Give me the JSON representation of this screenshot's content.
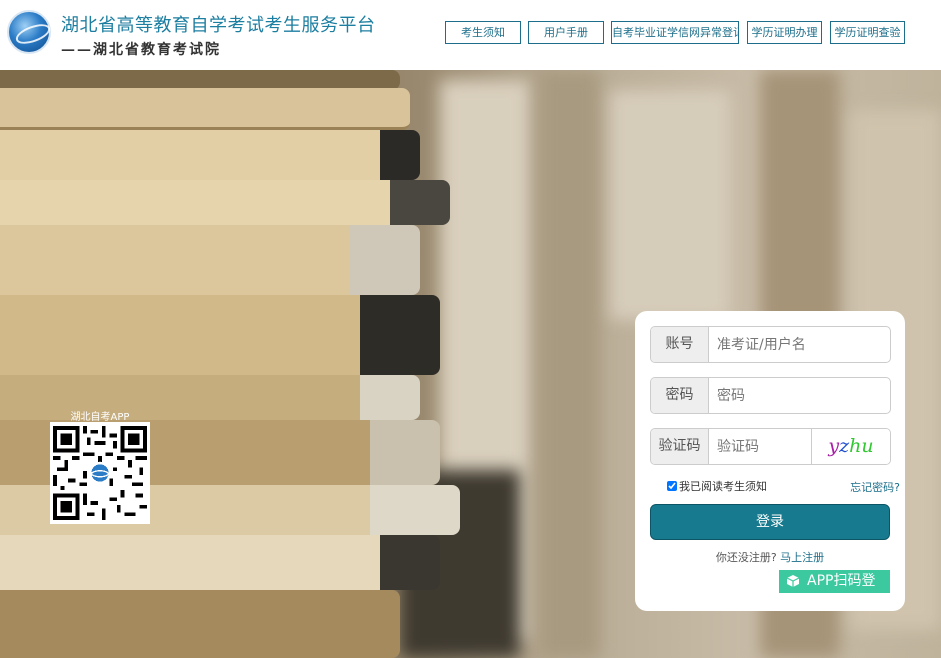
{
  "header": {
    "title": "湖北省高等教育自学考试考生服务平台",
    "subtitle": "——湖北省教育考试院"
  },
  "nav": [
    {
      "label": "考生须知"
    },
    {
      "label": "用户手册"
    },
    {
      "label": "自考毕业证学信网异常登记"
    },
    {
      "label": "学历证明办理"
    },
    {
      "label": "学历证明查验"
    }
  ],
  "qr": {
    "label": "湖北自考APP"
  },
  "login": {
    "account_label": "账号",
    "account_placeholder": "准考证/用户名",
    "password_label": "密码",
    "password_placeholder": "密码",
    "captcha_label": "验证码",
    "captcha_placeholder": "验证码",
    "captcha_chars": [
      "y",
      "z",
      "hu"
    ],
    "agree_text": "我已阅读考生须知",
    "agree_checked": true,
    "forgot_text": "忘记密码?",
    "login_button": "登录",
    "register_prompt": "你还没注册?",
    "register_link": "马上注册",
    "app_login": "APP扫码登"
  },
  "colors": {
    "accent": "#177a8e",
    "title": "#1c7ea0",
    "app_button": "#3cc9a0"
  }
}
